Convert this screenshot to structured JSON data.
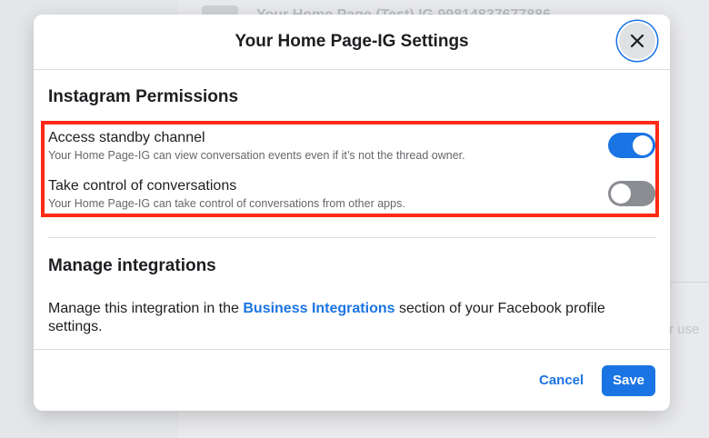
{
  "background": {
    "page_title": "Your Home Page (Test) IG 99814837677886",
    "side_text": "r use"
  },
  "modal": {
    "title": "Your Home Page-IG Settings",
    "close_icon": "close-icon",
    "permissions": {
      "heading": "Instagram Permissions",
      "items": [
        {
          "label": "Access standby channel",
          "description": "Your Home Page-IG can view conversation events even if it’s not the thread owner.",
          "enabled": true
        },
        {
          "label": "Take control of conversations",
          "description": "Your Home Page-IG can take control of conversations from other apps.",
          "enabled": false
        }
      ]
    },
    "integrations": {
      "heading": "Manage integrations",
      "text_before": "Manage this integration in the ",
      "link_text": "Business Integrations",
      "text_after": " section of your Facebook profile settings."
    },
    "footer": {
      "cancel_label": "Cancel",
      "save_label": "Save"
    }
  },
  "colors": {
    "accent": "#1b74e4",
    "highlight": "#ff2a14",
    "toggle_off": "#8a8d91"
  }
}
